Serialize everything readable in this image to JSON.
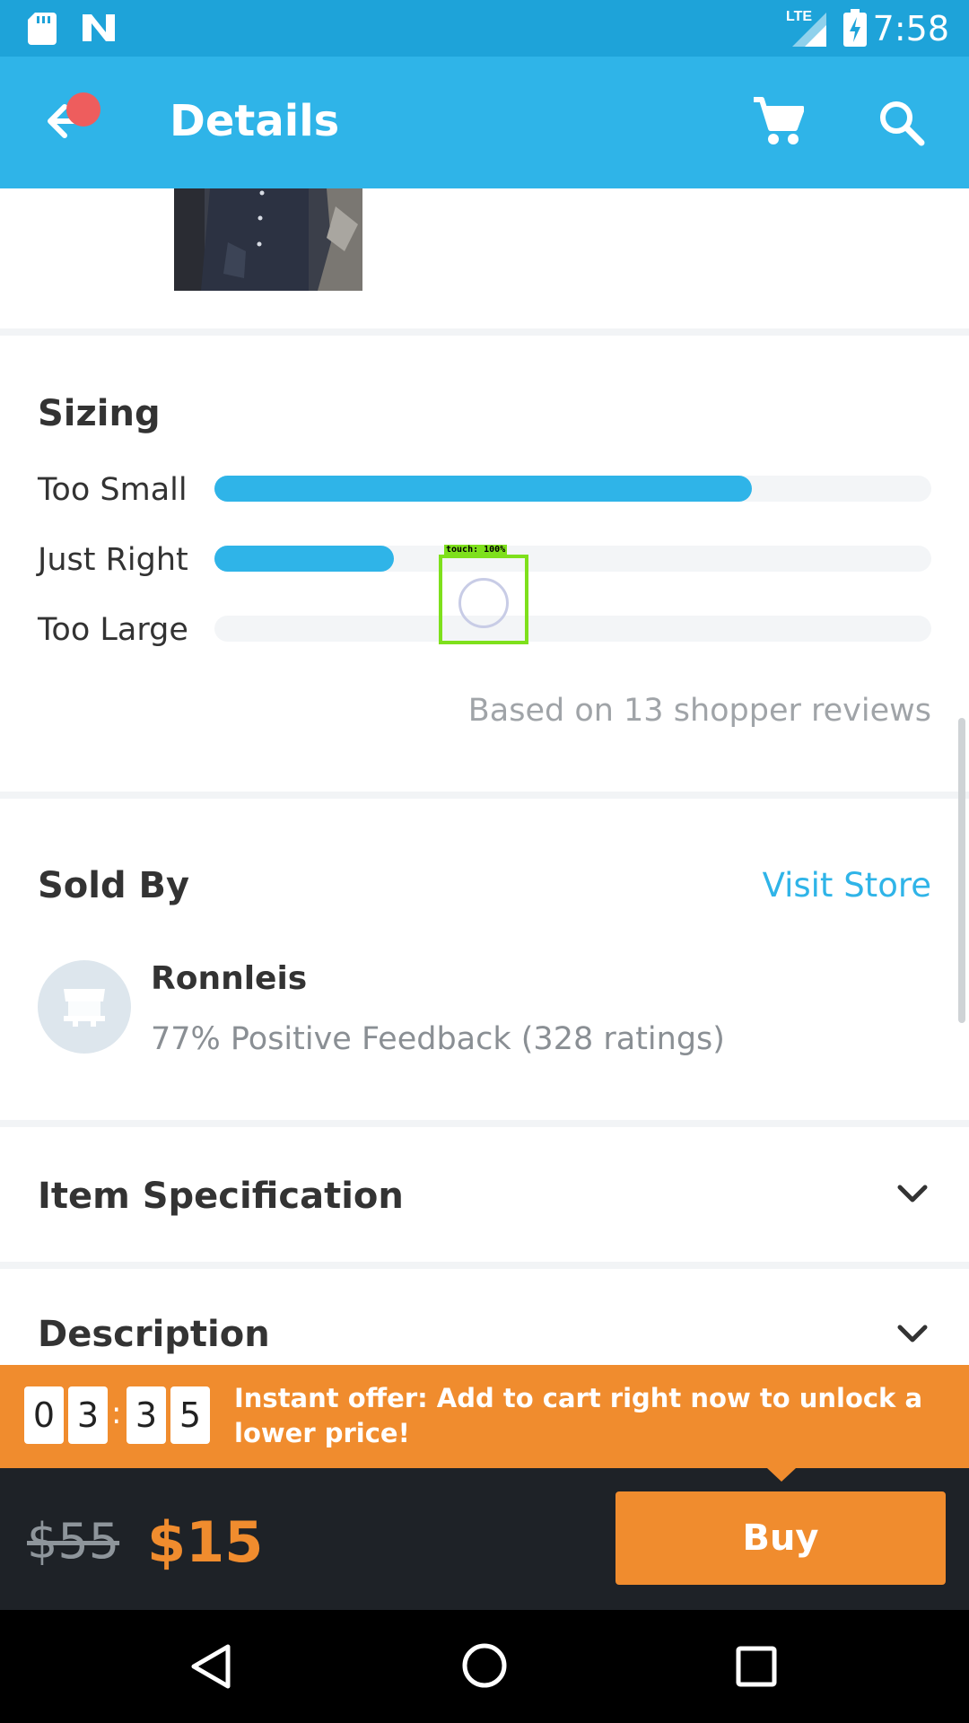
{
  "status_bar": {
    "time": "7:58",
    "network": "LTE"
  },
  "app_bar": {
    "title": "Details"
  },
  "sizing": {
    "title": "Sizing",
    "rows": [
      {
        "label": "Too Small",
        "fraction": 0.75
      },
      {
        "label": "Just Right",
        "fraction": 0.25
      },
      {
        "label": "Too Large",
        "fraction": 0.0
      }
    ],
    "footnote": "Based on 13 shopper reviews"
  },
  "touch_overlay": {
    "label": "touch: 100%"
  },
  "seller": {
    "title": "Sold By",
    "visit_label": "Visit Store",
    "name": "Ronnleis",
    "feedback": "77% Positive Feedback (328 ratings)"
  },
  "accordions": {
    "spec": "Item Specification",
    "description": "Description"
  },
  "offer": {
    "digits": [
      "0",
      "3",
      "3",
      "5"
    ],
    "separator": ":",
    "text": "Instant offer: Add to cart right now to unlock a lower price!"
  },
  "buy_bar": {
    "old_price": "$55",
    "price": "$15",
    "buy_label": "Buy"
  },
  "colors": {
    "accent": "#2fb4e8",
    "orange": "#f08c2e",
    "dark": "#1e2227"
  }
}
